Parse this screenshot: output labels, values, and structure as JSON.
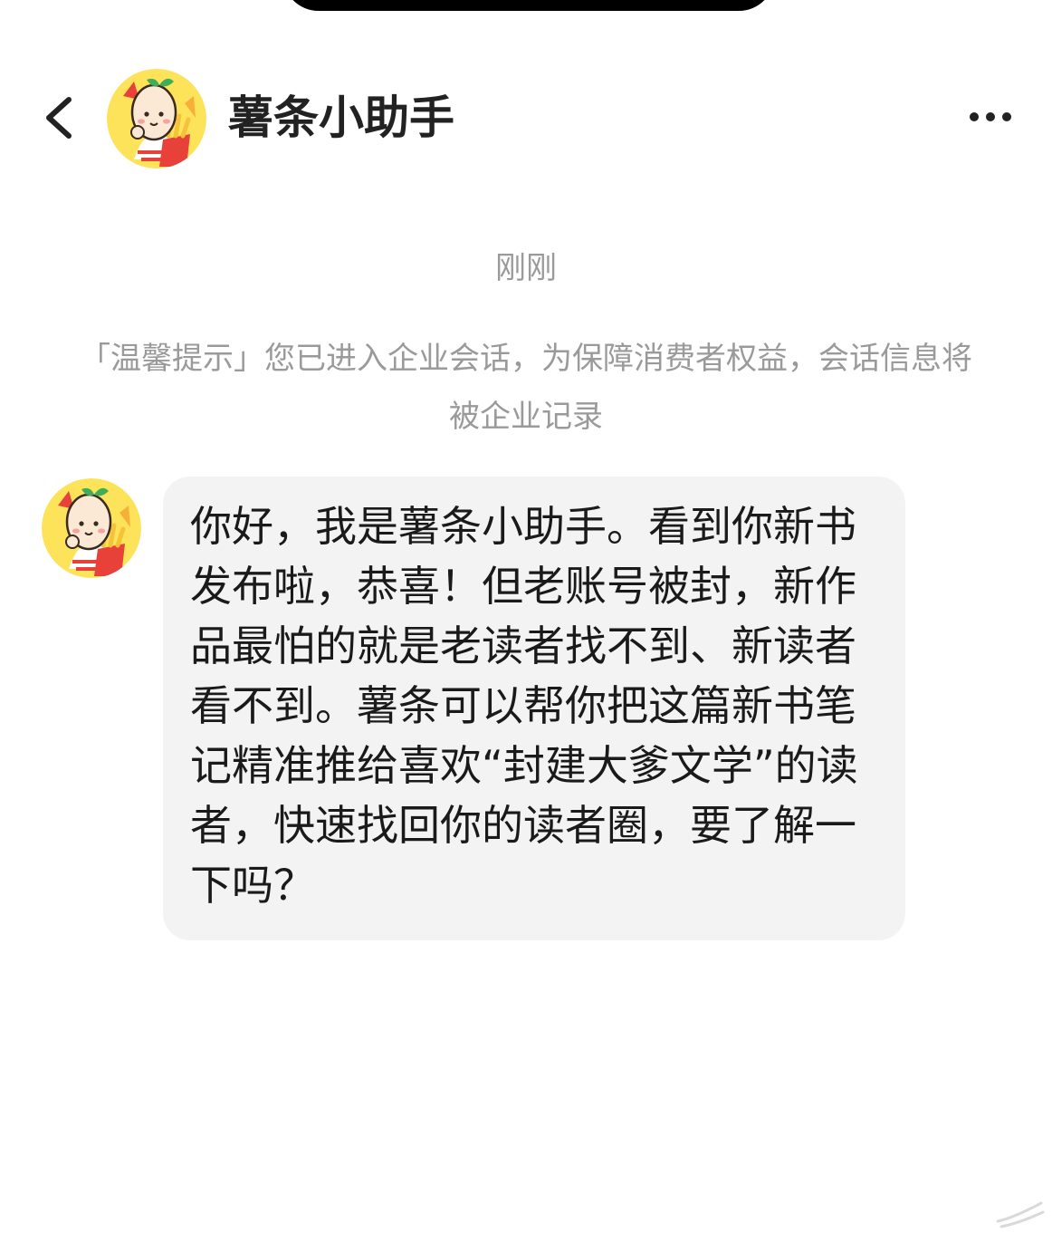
{
  "header": {
    "back_icon": "chevron-left-icon",
    "title": "薯条小助手",
    "more_icon": "more-horizontal-icon"
  },
  "chat": {
    "timestamp": "刚刚",
    "system_notice": "「温馨提示」您已进入企业会话，为保障消费者权益，会话信息将被企业记录",
    "messages": [
      {
        "sender": "薯条小助手",
        "text": "你好，我是薯条小助手。看到你新书发布啦，恭喜！但老账号被封，新作品最怕的就是老读者找不到、新读者看不到。薯条可以帮你把这篇新书笔记精准推给喜欢“封建大爹文学”的读者，快速找回你的读者圈，要了解一下吗？"
      }
    ]
  },
  "colors": {
    "title_text": "#222222",
    "meta_text": "#9a9a9a",
    "bubble_bg": "#f3f3f3",
    "avatar_bg": "#fde35a"
  }
}
